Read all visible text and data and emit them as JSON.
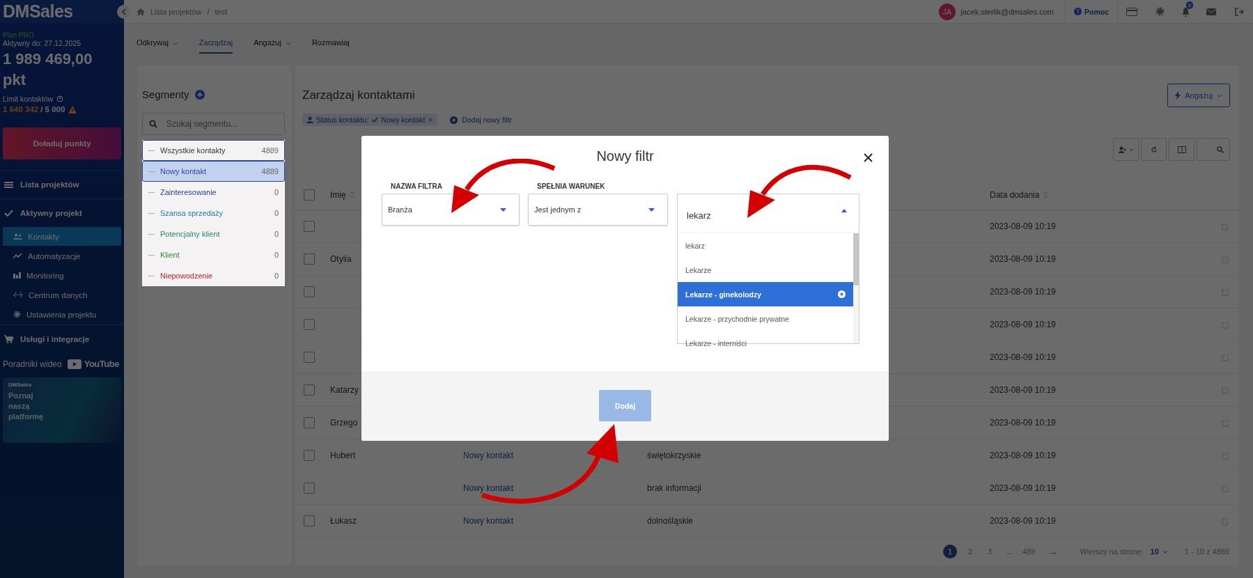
{
  "sidebar": {
    "logo": "DMSales",
    "plan": "Plan PRO",
    "active_until": "Aktywny do: 27.12.2025",
    "points": "1 989 469,00 pkt",
    "contact_limit_label": "Limit kontaktów",
    "contact_limit_used": "1 640 342",
    "contact_limit_total": "/ 5 000",
    "topup_button": "Doładuj punkty",
    "nav": [
      {
        "label": "Lista projektów"
      },
      {
        "label": "Aktywny projekt",
        "children": [
          {
            "label": "Kontakty",
            "selected": true
          },
          {
            "label": "Automatyzacje",
            "selected": false
          },
          {
            "label": "Monitoring",
            "selected": false
          },
          {
            "label": "Centrum danych",
            "selected": false
          },
          {
            "label": "Ustawienia projektu",
            "selected": false
          }
        ]
      },
      {
        "label": "Usługi i integracje"
      }
    ],
    "video_tutorials": "Poradniki wideo",
    "youtube": "YouTube",
    "promo": {
      "brand": "DMSales",
      "text": "Poznaj naszą platformę"
    }
  },
  "topbar": {
    "breadcrumb": [
      "Lista projektów",
      "test"
    ],
    "breadcrumb_separator": "/",
    "user": {
      "initials": "JA",
      "email": "jacek.sterlik@dmsales.com"
    },
    "help": "Pomoc",
    "notification_count": "8"
  },
  "tabs": [
    {
      "label": "Odkrywaj",
      "selected": false,
      "dropdown": true
    },
    {
      "label": "Zarządzaj",
      "selected": true,
      "dropdown": false
    },
    {
      "label": "Angażuj",
      "selected": false,
      "dropdown": true
    },
    {
      "label": "Rozmawiaj",
      "selected": false,
      "dropdown": false
    }
  ],
  "segments": {
    "title": "Segmenty",
    "search": {
      "placeholder": "Szukaj segmentu..."
    },
    "items": [
      {
        "label": "Wszystkie kontakty",
        "count": "4889",
        "color": "#333333",
        "selected": false,
        "kind": "all"
      },
      {
        "label": "Nowy kontakt",
        "count": "4889",
        "color": "#2a4b9b",
        "selected": true,
        "kind": "status"
      },
      {
        "label": "Zainteresowanie",
        "count": "0",
        "color": "#2d3f9e",
        "selected": false,
        "kind": "status"
      },
      {
        "label": "Szansa sprzedaży",
        "count": "0",
        "color": "#1f7aa3",
        "selected": false,
        "kind": "status"
      },
      {
        "label": "Potencjalny klient",
        "count": "0",
        "color": "#1f8a76",
        "selected": false,
        "kind": "status"
      },
      {
        "label": "Klient",
        "count": "0",
        "color": "#2a8a34",
        "selected": false,
        "kind": "status"
      },
      {
        "label": "Niepowodzenie",
        "count": "0",
        "color": "#d0211c",
        "selected": false,
        "kind": "status"
      }
    ]
  },
  "main": {
    "title": "Zarządzaj kontaktami",
    "engage_button": "Angażuj",
    "filter_chip": {
      "label": "Status kontaktu:",
      "value": "Nowy kontakt"
    },
    "add_filter": "Dodaj nowy filtr",
    "table": {
      "header": {
        "checked": false,
        "name": "Imię",
        "date": "Data dodania"
      },
      "rows": [
        {
          "checked": false,
          "name": "",
          "date": "2023-08-09 10:19"
        },
        {
          "checked": false,
          "name": "Otylia",
          "date": "2023-08-09 10:19"
        },
        {
          "checked": false,
          "name": "",
          "date": "2023-08-09 10:19"
        },
        {
          "checked": false,
          "name": "",
          "date": "2023-08-09 10:19"
        },
        {
          "checked": false,
          "name": "",
          "date": "2023-08-09 10:19"
        },
        {
          "checked": false,
          "name": "Katarzy",
          "date": "2023-08-09 10:19"
        },
        {
          "checked": false,
          "name": "Grzego",
          "date": "2023-08-09 10:19"
        },
        {
          "checked": false,
          "name": "Hubert",
          "status": "Nowy kontakt",
          "region": "świętokrzyskie",
          "date": "2023-08-09 10:19"
        },
        {
          "checked": false,
          "name": "",
          "status": "Nowy kontakt",
          "region": "brak informacji",
          "date": "2023-08-09 10:19"
        },
        {
          "checked": false,
          "name": "Łukasz",
          "status": "Nowy kontakt",
          "region": "dolnośląskie",
          "date": "2023-08-09 10:19"
        }
      ]
    },
    "pagination": {
      "pages": [
        {
          "label": "1",
          "selected": true
        },
        {
          "label": "2",
          "selected": false
        },
        {
          "label": "3",
          "selected": false
        },
        {
          "label": "...",
          "selected": false
        },
        {
          "label": "489",
          "selected": false
        }
      ],
      "next": "→",
      "rows_per_page_label": "Wierszy na stronę:",
      "rows_per_page": "10",
      "range": "1 - 10 z 4889"
    }
  },
  "modal": {
    "title": "Nowy filtr",
    "fields": [
      {
        "label": "NAZWA FILTRA",
        "value": "Branża"
      },
      {
        "label": "SPEŁNIA WARUNEK",
        "value": "Jest jednym z"
      }
    ],
    "value_search": {
      "value": "lekarz",
      "expanded": true
    },
    "options": [
      {
        "label": "lekarz",
        "selected": false
      },
      {
        "label": "Lekarze",
        "selected": false
      },
      {
        "label": "Lekarze - ginekolodzy",
        "selected": true
      },
      {
        "label": "Lekarze - przychodnie prywatne",
        "selected": false
      },
      {
        "label": "Lekarze - interniści",
        "selected": false
      }
    ],
    "submit": {
      "label": "Dodaj",
      "disabled": true
    }
  }
}
